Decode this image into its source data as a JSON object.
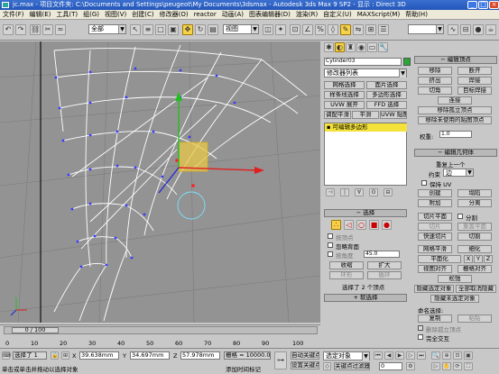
{
  "title": "jc.max  - 项目文件夹: C:\\Documents and Settings\\peugeot\\My Documents\\3dsmax   - Autodesk 3ds Max 9 SP2   - 显示 : Direct 3D",
  "menu": [
    "文件(F)",
    "编辑(E)",
    "工具(T)",
    "组(G)",
    "视图(V)",
    "创建(C)",
    "修改器(O)",
    "reactor",
    "动画(A)",
    "图表编辑器(D)",
    "渲染(R)",
    "自定义(U)",
    "MAXScript(M)",
    "帮助(H)"
  ],
  "toolbar": {
    "filter_combo": "全部",
    "view_combo": "视图"
  },
  "viewport": {
    "label": ""
  },
  "command_panel": {
    "object_name": "Cylinder03",
    "modifier_list": "修改器列表",
    "modifier_buttons": [
      "网格选择",
      "面片选择",
      "样条线选择",
      "多边形选择",
      "UVW 展开",
      "FFD 选择",
      "调配平滑",
      "平滑",
      "UVW 贴图"
    ],
    "stack_item": "可编辑多边形",
    "selection_header": "选择",
    "ignore_backfacing": "忽略背面",
    "by_vertex": "按顶点",
    "by_angle": "按角度",
    "angle_value": "45.0",
    "shrink": "收缩",
    "grow": "扩大",
    "ring": "环形",
    "loop": "循环",
    "selected_count": "选择了 2 个顶点",
    "soft_selection": "软选择"
  },
  "edit_vertices": {
    "header": "编辑顶点",
    "remove": "移除",
    "break": "断开",
    "extrude": "挤出",
    "weld": "焊接",
    "chamfer": "切角",
    "target_weld": "目标焊接",
    "connect": "连接",
    "remove_isolated": "移除孤立顶点",
    "remove_unused_map": "移除未使用的贴图顶点",
    "weight_label": "权重:",
    "weight_value": "1.0"
  },
  "edit_geometry": {
    "header": "编辑几何体",
    "repeat_last": "重复上一个",
    "constraints_label": "约束",
    "constraints_value": "边",
    "preserve_uv": "保持 UV",
    "create": "创建",
    "collapse": "塌陷",
    "attach": "附加",
    "detach": "分离",
    "slice_plane": "切片平面",
    "split": "分割",
    "slice": "切片",
    "reset_plane": "重置平面",
    "quickslice": "快速切片",
    "cut": "切割",
    "msmooth": "网格平滑",
    "tessellate": "细化",
    "make_planar": "平面化",
    "x": "X",
    "y": "Y",
    "z": "Z",
    "view_align": "视图对齐",
    "grid_align": "栅格对齐",
    "relax": "松弛",
    "hide_selected": "隐藏选定对象",
    "unhide_all": "全部取消隐藏",
    "hide_unselected": "隐藏未选定对象",
    "named_selections": "命名选择:",
    "copy": "复制",
    "paste": "粘贴",
    "delete_isolated": "删除孤立顶点",
    "full_interactivity": "完全交互"
  },
  "timeline": {
    "frame": "0 / 100",
    "ticks": [
      "0",
      "10",
      "20",
      "30",
      "40",
      "50",
      "60",
      "70",
      "80",
      "90",
      "100"
    ]
  },
  "status": {
    "selected": "选择了 1",
    "x_label": "X",
    "x_value": "39.638mm",
    "y_label": "Y",
    "y_value": "34.697mm",
    "z_label": "Z",
    "z_value": "57.978mm",
    "grid": "栅格 = 10000.0m",
    "auto_key": "自动关键点",
    "set_key": "设置关键点",
    "selection_combo": "选定对象",
    "key_filters": "关键点过滤器...",
    "prompt": "单击或单击并拖动以选择对象",
    "add_time_tag": "添加时间标记",
    "frame_value": "0"
  }
}
